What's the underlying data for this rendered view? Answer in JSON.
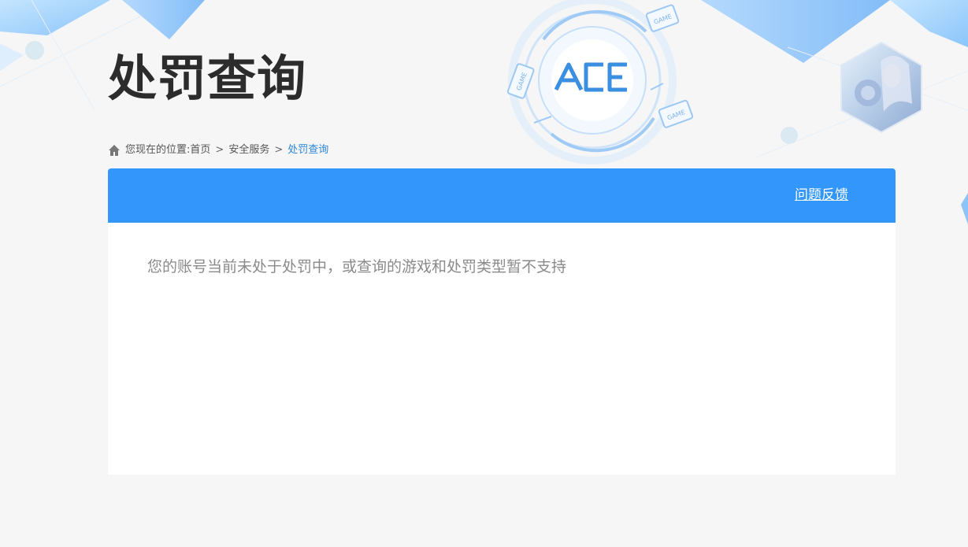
{
  "page": {
    "title": "处罚查询"
  },
  "breadcrumb": {
    "prefix": "您现在的位置:",
    "items": [
      {
        "label": "首页"
      },
      {
        "label": "安全服务"
      },
      {
        "label": "处罚查询"
      }
    ],
    "separator": ">"
  },
  "logo": {
    "text": "ACE",
    "badge_text": "GAME"
  },
  "card": {
    "feedback_label": "问题反馈",
    "message": "您的账号当前未处于处罚中，或查询的游戏和处罚类型暂不支持"
  },
  "colors": {
    "accent": "#3396fb",
    "breadcrumb_current": "#2b86d8",
    "title": "#2c2c2c",
    "background": "#f6f6f6"
  },
  "icons": [
    "home-icon",
    "ace-logo",
    "game-badge-icon",
    "avatar-hex"
  ]
}
